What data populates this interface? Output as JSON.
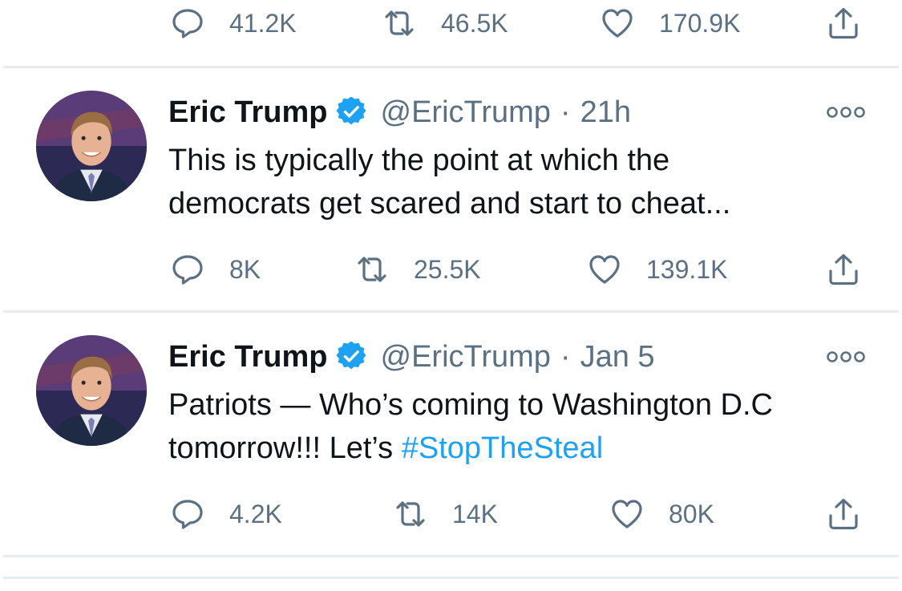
{
  "top_action_bar": {
    "replies": "41.2K",
    "retweets": "46.5K",
    "likes": "170.9K"
  },
  "tweets": [
    {
      "name": "Eric Trump",
      "handle": "@EricTrump",
      "separator": "·",
      "time": "21h",
      "text_line1": "This is typically the point at which the",
      "text_line2": "democrats get scared and start to cheat...",
      "replies": "8K",
      "retweets": "25.5K",
      "likes": "139.1K"
    },
    {
      "name": "Eric Trump",
      "handle": "@EricTrump",
      "separator": "·",
      "time": "Jan 5",
      "text_line1": "Patriots — Who’s coming to Washington D.C",
      "text_line2_prefix": "tomorrow!!! Let’s ",
      "text_line2_hashtag": "#StopTheSteal",
      "replies": "4.2K",
      "retweets": "14K",
      "likes": "80K"
    }
  ],
  "colors": {
    "text": "#0f1419",
    "secondary": "#5b7083",
    "accent": "#1da1f2",
    "divider": "#e6ecf0"
  },
  "icons": {
    "reply": "reply-icon",
    "retweet": "retweet-icon",
    "like": "like-icon",
    "share": "share-icon",
    "verified": "verified-badge-icon",
    "more": "more-options-icon"
  }
}
